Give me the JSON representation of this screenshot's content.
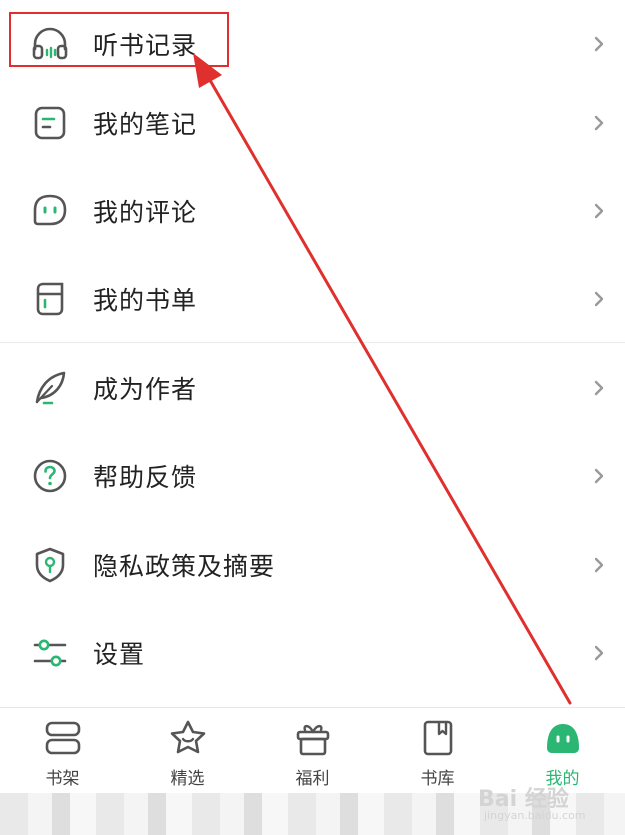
{
  "menu": {
    "items": [
      {
        "label": "听书记录",
        "icon": "headphones-icon"
      },
      {
        "label": "我的笔记",
        "icon": "note-icon"
      },
      {
        "label": "我的评论",
        "icon": "comment-icon"
      },
      {
        "label": "我的书单",
        "icon": "booklist-icon"
      },
      {
        "label": "成为作者",
        "icon": "feather-icon"
      },
      {
        "label": "帮助反馈",
        "icon": "help-icon"
      },
      {
        "label": "隐私政策及摘要",
        "icon": "privacy-shield-icon"
      },
      {
        "label": "设置",
        "icon": "settings-sliders-icon"
      }
    ]
  },
  "tabbar": {
    "tabs": [
      {
        "label": "书架",
        "icon": "bookshelf-icon"
      },
      {
        "label": "精选",
        "icon": "featured-star-icon"
      },
      {
        "label": "福利",
        "icon": "gift-icon"
      },
      {
        "label": "书库",
        "icon": "library-icon"
      },
      {
        "label": "我的",
        "icon": "profile-icon",
        "active": true
      }
    ]
  },
  "watermark": {
    "text": "Bai 经验",
    "sub": "jingyan.baidu.com"
  },
  "colors": {
    "accent": "#2bb673",
    "annotation": "#e0302e",
    "text": "#222222",
    "chevron": "#9a9a9a"
  }
}
